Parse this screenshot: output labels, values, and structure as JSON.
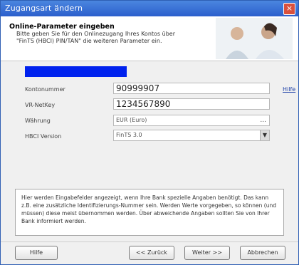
{
  "window": {
    "title": "Zugangsart ändern",
    "close_symbol": "×"
  },
  "header": {
    "title": "Online-Parameter eingeben",
    "subtitle": "Bitte geben Sie für den Onlinezugang Ihres Kontos über \"FinTS (HBCI) PIN/TAN\" die weiteren Parameter ein."
  },
  "form": {
    "fields": [
      {
        "label": "Kontonummer",
        "value": "90999907"
      },
      {
        "label": "VR-NetKey",
        "value": "1234567890"
      },
      {
        "label": "Währung",
        "value": "EUR (Euro)",
        "button_label": "..."
      },
      {
        "label": "HBCI Version",
        "value": "FinTS 3.0",
        "arrow": "▼"
      }
    ],
    "help_link": "Hilfe"
  },
  "info_text": "Hier werden Eingabefelder angezeigt, wenn Ihre Bank spezielle Angaben benötigt. Das kann z.B. eine zusätzliche Identifizierungs-Nummer sein. Werden Werte vorgegeben, so können (und müssen) diese meist übernommen werden. Über abweichende Angaben sollten Sie von Ihrer Bank informiert werden.",
  "buttons": {
    "help": "Hilfe",
    "back": "<< Zurück",
    "next": "Weiter >>",
    "cancel": "Abbrechen"
  },
  "colors": {
    "title_bar": "#2b5fcc",
    "accent_bar": "#0022ee",
    "close": "#d9503d"
  }
}
